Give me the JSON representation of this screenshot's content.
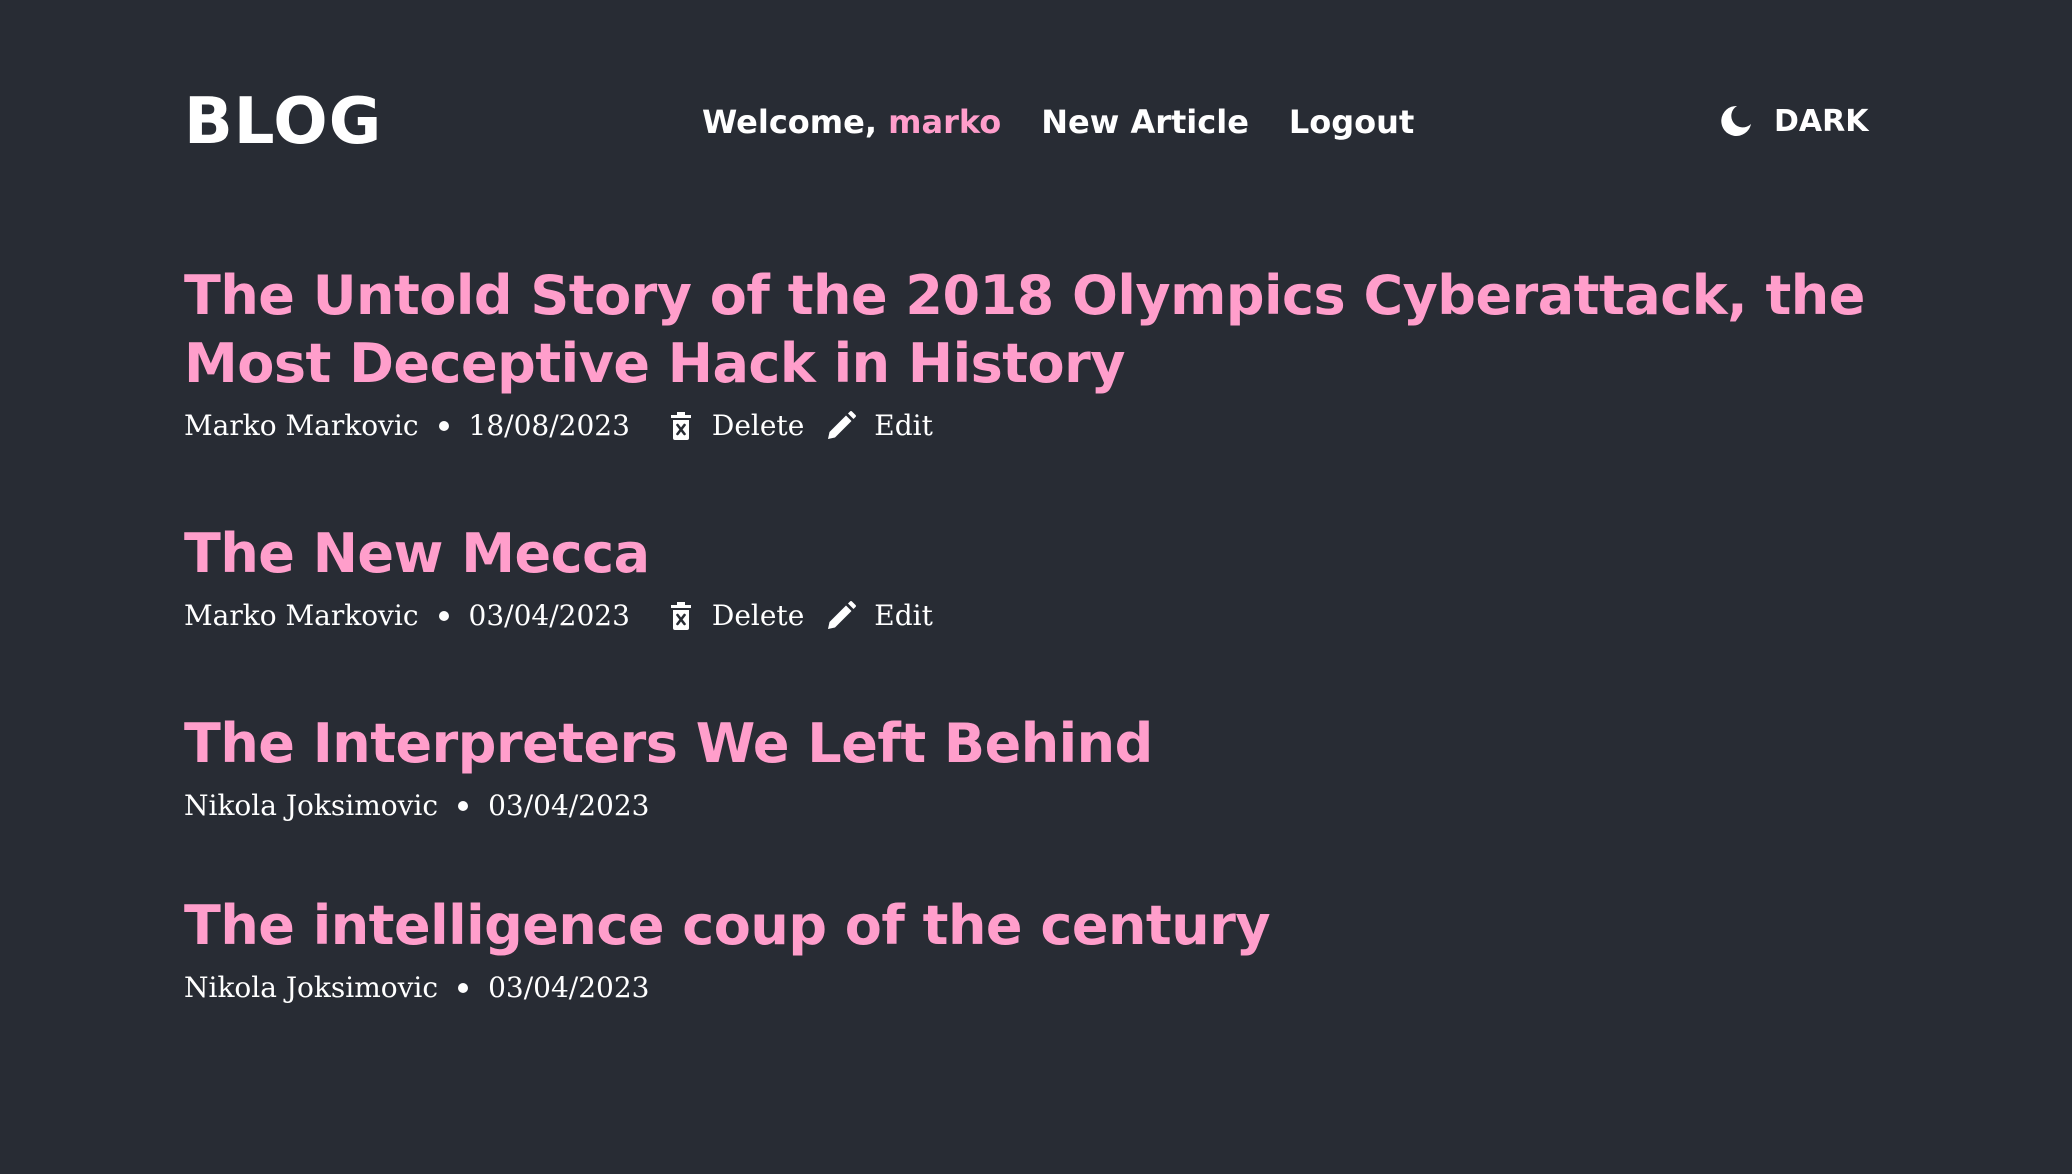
{
  "header": {
    "logo": "BLOG",
    "welcome_prefix": "Welcome, ",
    "username": "marko",
    "nav": {
      "new_article": "New Article",
      "logout": "Logout"
    },
    "theme_toggle": {
      "label": "DARK",
      "icon": "moon-icon"
    }
  },
  "articles": [
    {
      "title": "The Untold Story of the 2018 Olympics Cyberattack, the Most Deceptive Hack in History",
      "author": "Marko Markovic",
      "date": "18/08/2023",
      "delete_label": "Delete",
      "edit_label": "Edit"
    },
    {
      "title": "The New Mecca",
      "author": "Marko Markovic",
      "date": "03/04/2023",
      "delete_label": "Delete",
      "edit_label": "Edit"
    },
    {
      "title": "The Interpreters We Left Behind",
      "author": "Nikola Joksimovic",
      "date": "03/04/2023"
    },
    {
      "title": "The intelligence coup of the century",
      "author": "Nikola Joksimovic",
      "date": "03/04/2023"
    }
  ],
  "colors": {
    "background": "#282c34",
    "accent": "#ff9ecb",
    "text": "#ffffff"
  }
}
